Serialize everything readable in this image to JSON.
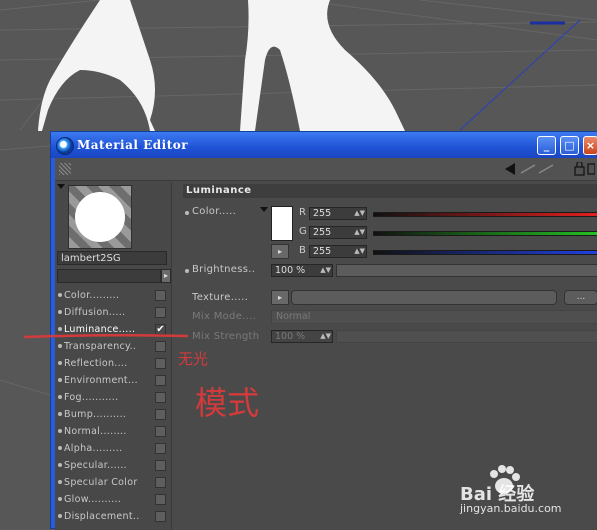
{
  "window": {
    "title": "Material Editor"
  },
  "material": {
    "name": "lambert2SG"
  },
  "channels": [
    {
      "label": "Color.........",
      "checked": false
    },
    {
      "label": "Diffusion.....",
      "checked": false
    },
    {
      "label": "Luminance.....",
      "checked": true
    },
    {
      "label": "Transparency..",
      "checked": false
    },
    {
      "label": "Reflection....",
      "checked": false
    },
    {
      "label": "Environment...",
      "checked": false
    },
    {
      "label": "Fog...........",
      "checked": false
    },
    {
      "label": "Bump..........",
      "checked": false
    },
    {
      "label": "Normal........",
      "checked": false
    },
    {
      "label": "Alpha.........",
      "checked": false
    },
    {
      "label": "Specular......",
      "checked": false
    },
    {
      "label": "Specular Color",
      "checked": false
    },
    {
      "label": "Glow..........",
      "checked": false
    },
    {
      "label": "Displacement..",
      "checked": false
    }
  ],
  "checkmark": "✔",
  "luminance": {
    "section_title": "Luminance",
    "color_label": "Color.....",
    "r_label": "R",
    "g_label": "G",
    "b_label": "B",
    "r": "255",
    "g": "255",
    "b": "255",
    "brightness_label": "Brightness..",
    "brightness": "100 %",
    "texture_label": "Texture.....",
    "texture_more": "...",
    "mixmode_label": "Mix Mode....",
    "mixmode_value": "Normal",
    "mixstrength_label": "Mix Strength",
    "mixstrength_value": "100 %"
  },
  "annotation": {
    "small": "无光",
    "large": "模式"
  },
  "watermark": {
    "brand": "Bai 经验",
    "url": "jingyan.baidu.com"
  },
  "colors": {
    "red": "#e02020",
    "green": "#22c022",
    "blue": "#2040e0",
    "title_blue": "#2a5bd8",
    "annotation": "#d23b3b"
  }
}
